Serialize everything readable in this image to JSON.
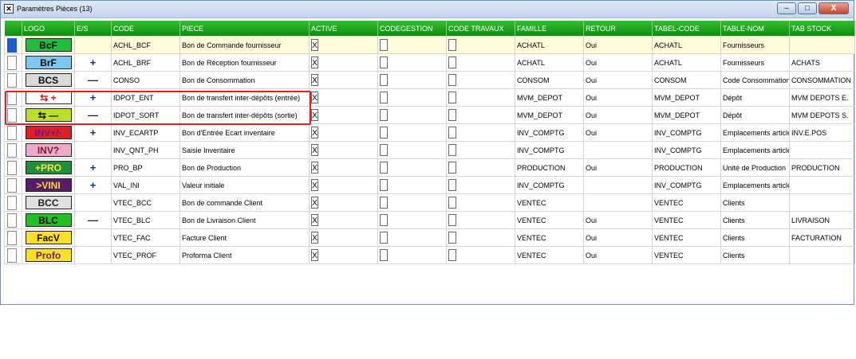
{
  "window": {
    "title": "Paramètres Pièces (13)",
    "min": "–",
    "max": "□",
    "close": "X"
  },
  "columns": [
    "",
    "LOGO",
    "E/S",
    "CODE",
    "PIECE",
    "ACTIVE",
    "CODEGESTION",
    "CODE TRAVAUX",
    "FAMILLE",
    "RETOUR",
    "TABEL-CODE",
    "TABLE-NOM",
    "TAB STOCK"
  ],
  "rows": [
    {
      "logo": {
        "text": "BcF",
        "bg": "#1fbf3a",
        "fg": "#0a0a0a",
        "font": "serif",
        "italic": true
      },
      "es": "",
      "code": "ACHL_BCF",
      "piece": "Bon de Commande fournisseur",
      "active": "X",
      "famille": "ACHATL",
      "retour": "Oui",
      "tabel_code": "ACHATL",
      "table_nom": "Fournisseurs",
      "tab_stock": ""
    },
    {
      "logo": {
        "text": "BrF",
        "bg": "#7cc8f0",
        "fg": "#0a0a0a",
        "font": "sans",
        "italic": false
      },
      "es": "+",
      "code": "ACHL_BRF",
      "piece": "Bon de Réception fournisseur",
      "active": "X",
      "famille": "ACHATL",
      "retour": "Oui",
      "tabel_code": "ACHATL",
      "table_nom": "Fournisseurs",
      "tab_stock": "ACHATS"
    },
    {
      "logo": {
        "text": "BCS",
        "bg": "#d9d9d9",
        "fg": "#0a0a0a",
        "font": "serif",
        "italic": true
      },
      "es": "—",
      "code": "CONSO",
      "piece": "Bon de Consommation",
      "active": "X",
      "famille": "CONSOM",
      "retour": "Oui",
      "tabel_code": "CONSOM",
      "table_nom": "Code Consommation",
      "tab_stock": "CONSOMMATION"
    },
    {
      "logo": {
        "text": "⇆ +",
        "bg": "#ffffff",
        "fg": "#d01818",
        "font": "sans",
        "italic": false
      },
      "es": "+",
      "code": "IDPOT_ENT",
      "piece": "Bon de transfert inter-dépôts (entrée)",
      "active": "X",
      "famille": "MVM_DEPOT",
      "retour": "Oui",
      "tabel_code": "MVM_DEPOT",
      "table_nom": "Dépôt",
      "tab_stock": "MVM DEPOTS E."
    },
    {
      "logo": {
        "text": "⇆ —",
        "bg": "#b8e02a",
        "fg": "#111111",
        "font": "sans",
        "italic": false
      },
      "es": "—",
      "code": "IDPOT_SORT",
      "piece": "Bon de transfert inter-dépôts (sortie)",
      "active": "X",
      "famille": "MVM_DEPOT",
      "retour": "Oui",
      "tabel_code": "MVM_DEPOT",
      "table_nom": "Dépôt",
      "tab_stock": "MVM DEPOTS S."
    },
    {
      "logo": {
        "text": "INV+/-",
        "bg": "#e02020",
        "fg": "#6a1a8a",
        "font": "serif",
        "italic": false
      },
      "es": "+",
      "code": "INV_ECARTP",
      "piece": "Bon d'Entrée Ecart inventaire",
      "active": "X",
      "famille": "INV_COMPTG",
      "retour": "Oui",
      "tabel_code": "INV_COMPTG",
      "table_nom": "Emplacements articles",
      "tab_stock": "INV.E.POS"
    },
    {
      "logo": {
        "text": "INV?",
        "bg": "#f0a8c8",
        "fg": "#7a1a2a",
        "font": "serif",
        "italic": false
      },
      "es": "",
      "code": "INV_QNT_PH",
      "piece": "Saisie Inventaire",
      "active": "X",
      "famille": "INV_COMPTG",
      "retour": "",
      "tabel_code": "INV_COMPTG",
      "table_nom": "Emplacements articles",
      "tab_stock": ""
    },
    {
      "logo": {
        "text": "+PRO",
        "bg": "#1f8f3a",
        "fg": "#ffe040",
        "font": "serif",
        "italic": false
      },
      "es": "+",
      "code": "PRO_BP",
      "piece": "Bon de Production",
      "active": "X",
      "famille": "PRODUCTION",
      "retour": "Oui",
      "tabel_code": "PRODUCTION",
      "table_nom": "Unité de Production",
      "tab_stock": "PRODUCTION"
    },
    {
      "logo": {
        "text": ">VINI",
        "bg": "#5a1a6a",
        "fg": "#f0e020",
        "font": "serif",
        "italic": false
      },
      "es": "+",
      "code": "VAL_INI",
      "piece": "Valeur initiale",
      "active": "X",
      "famille": "INV_COMPTG",
      "retour": "",
      "tabel_code": "INV_COMPTG",
      "table_nom": "Emplacements articles",
      "tab_stock": ""
    },
    {
      "logo": {
        "text": "BCC",
        "bg": "#e0e0e0",
        "fg": "#222222",
        "font": "serif",
        "italic": true
      },
      "es": "",
      "code": "VTEC_BCC",
      "piece": "Bon de commande Client",
      "active": "X",
      "famille": "VENTEC",
      "retour": "",
      "tabel_code": "VENTEC",
      "table_nom": "Clients",
      "tab_stock": ""
    },
    {
      "logo": {
        "text": "BLC",
        "bg": "#22c022",
        "fg": "#0a0a0a",
        "font": "sans",
        "italic": false
      },
      "es": "—",
      "code": "VTEC_BLC",
      "piece": "Bon de Livraison Client",
      "active": "X",
      "famille": "VENTEC",
      "retour": "Oui",
      "tabel_code": "VENTEC",
      "table_nom": "Clients",
      "tab_stock": "LIVRAISON"
    },
    {
      "logo": {
        "text": "FacV",
        "bg": "#ffe020",
        "fg": "#0a0a0a",
        "font": "sans",
        "italic": false
      },
      "es": "",
      "code": "VTEC_FAC",
      "piece": "Facture Client",
      "active": "X",
      "famille": "VENTEC",
      "retour": "Oui",
      "tabel_code": "VENTEC",
      "table_nom": "Clients",
      "tab_stock": "FACTURATION"
    },
    {
      "logo": {
        "text": "Profo",
        "bg": "#ffe020",
        "fg": "#6a1a8a",
        "font": "serif",
        "italic": true
      },
      "es": "",
      "code": "VTEC_PROF",
      "piece": "Proforma Client",
      "active": "X",
      "famille": "VENTEC",
      "retour": "Oui",
      "tabel_code": "VENTEC",
      "table_nom": "Clients",
      "tab_stock": ""
    }
  ]
}
